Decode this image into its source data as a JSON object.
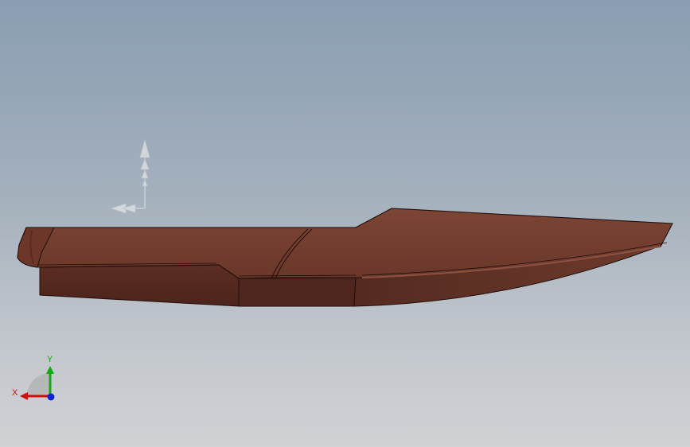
{
  "viewport": {
    "background_top": "#8a9db2",
    "background_bottom": "#d0d2d5"
  },
  "model": {
    "color_deck": "#733e30",
    "color_side": "#54281f",
    "color_edge": "#1f0f0b"
  },
  "triad": {
    "x_label": "X",
    "y_label": "Y",
    "x_color": "#cc1111",
    "y_color": "#11aa11",
    "z_color": "#1122cc"
  },
  "icons": {
    "reference_triad": "move-arrows-icon",
    "view_orientation": "axis-triad-icon"
  }
}
